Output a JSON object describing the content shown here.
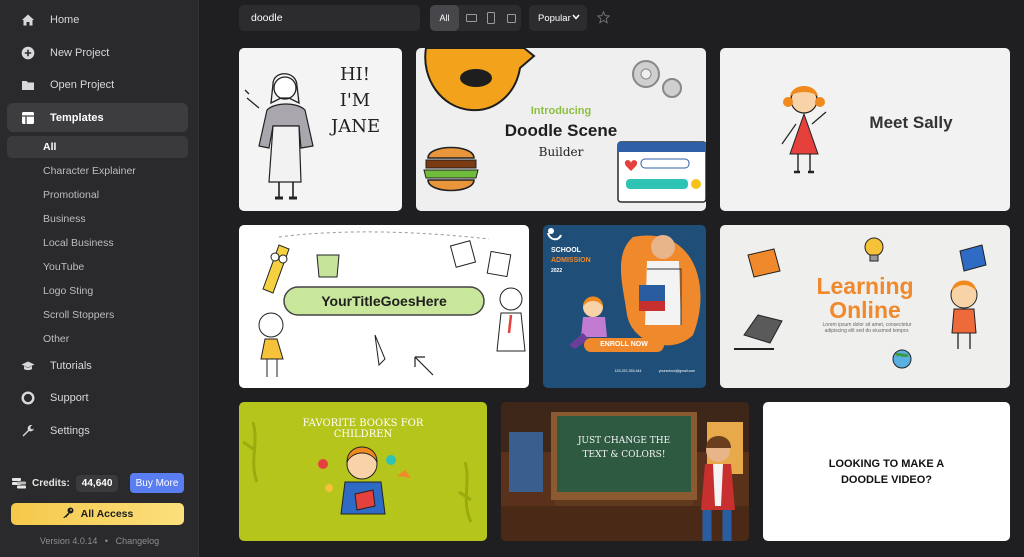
{
  "nav": {
    "home": "Home",
    "new_project": "New Project",
    "open_project": "Open Project",
    "templates": "Templates",
    "tutorials": "Tutorials",
    "support": "Support",
    "settings": "Settings"
  },
  "template_categories": [
    "All",
    "Character Explainer",
    "Promotional",
    "Business",
    "Local Business",
    "YouTube",
    "Logo Sting",
    "Scroll Stoppers",
    "Other"
  ],
  "account": {
    "credits_label": "Credits:",
    "credits_value": "44,640",
    "buy_more": "Buy More",
    "all_access": "All Access",
    "version": "Version 4.0.14",
    "separator": "•",
    "changelog": "Changelog"
  },
  "toolbar": {
    "search_value": "doodle",
    "filter_all": "All",
    "sort": "Popular"
  },
  "cards": {
    "c1": {
      "line1": "HI!",
      "line2": "I'M",
      "line3": "JANE"
    },
    "c2": {
      "line1": "Introducing",
      "line2": "Doodle Scene",
      "line3": "Builder"
    },
    "c3": {
      "title": "Meet Sally"
    },
    "c4": {
      "title": "YourTitleGoesHere"
    },
    "c5": {
      "line1": "SCHOOL",
      "line2": "ADMISSION",
      "line3": "2022",
      "button": "ENROLL NOW",
      "phone": "123-222-333-444",
      "email": "yourschool@gmail.com"
    },
    "c6": {
      "line1": "Learning",
      "line2": "Online",
      "body": "Lorem ipsum dolor sit amet, consectetur adipiscing elit sed do eiusmod tempor."
    },
    "c7": {
      "title": "FAVORITE BOOKS FOR CHILDREN"
    },
    "c8": {
      "line1": "JUST CHANGE THE",
      "line2": "TEXT & COLORS!"
    },
    "c9": {
      "line1": "LOOKING TO MAKE A",
      "line2": "DOODLE VIDEO?"
    }
  },
  "colors": {
    "accent_blue": "#5a7df2",
    "all_access_gold": "#f5c84a",
    "learning_orange": "#f0892b",
    "admission_blue": "#1f4f78"
  }
}
